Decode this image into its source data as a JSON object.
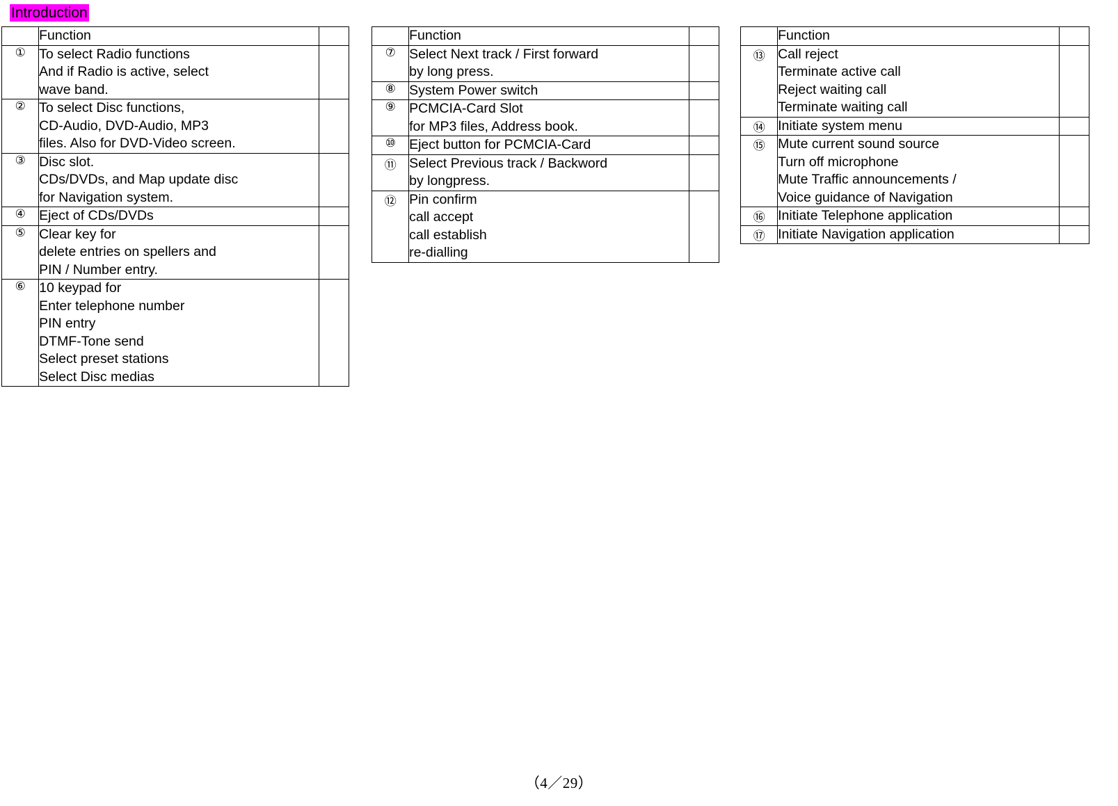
{
  "heading": "Introduction",
  "footer": "（4／29）",
  "tables": [
    {
      "id": "table-1",
      "header": "Function",
      "rows": [
        {
          "num": "①",
          "lines": [
            "To select Radio functions",
            "And if Radio is active, select",
            "wave band."
          ]
        },
        {
          "num": "②",
          "lines": [
            "To select Disc functions,",
            "CD-Audio, DVD-Audio, MP3",
            "files. Also for DVD-Video screen."
          ]
        },
        {
          "num": "③",
          "lines": [
            "Disc slot.",
            "CDs/DVDs, and Map update disc",
            "for Navigation system."
          ]
        },
        {
          "num": "④",
          "lines": [
            "Eject of CDs/DVDs"
          ]
        },
        {
          "num": "⑤",
          "lines": [
            "Clear key for",
            "delete entries on spellers and",
            "PIN / Number entry."
          ]
        },
        {
          "num": "⑥",
          "lines": [
            "10 keypad for",
            "Enter telephone number",
            "PIN entry",
            "DTMF-Tone send",
            "Select preset stations",
            "Select Disc medias"
          ]
        }
      ]
    },
    {
      "id": "table-2",
      "header": "Function",
      "rows": [
        {
          "num": "⑦",
          "lines": [
            "Select Next track / First forward",
            "by long press."
          ]
        },
        {
          "num": "⑧",
          "lines": [
            "System Power switch"
          ]
        },
        {
          "num": "⑨",
          "lines": [
            "PCMCIA-Card Slot",
            "for MP3 files, Address book."
          ]
        },
        {
          "num": "⑩",
          "lines": [
            "Eject button for PCMCIA-Card"
          ]
        },
        {
          "num": "⑪",
          "lines": [
            "Select Previous track / Backword",
            "by longpress."
          ]
        },
        {
          "num": "⑫",
          "lines": [
            "Pin confirm",
            "call accept",
            "call establish",
            "re-dialling"
          ]
        }
      ]
    },
    {
      "id": "table-3",
      "header": "Function",
      "rows": [
        {
          "num": "⑬",
          "lines": [
            "Call reject",
            "Terminate active call",
            "Reject waiting call",
            "Terminate waiting call"
          ]
        },
        {
          "num": "⑭",
          "lines": [
            "Initiate system menu"
          ]
        },
        {
          "num": "⑮",
          "lines": [
            "Mute current sound source",
            "Turn off microphone",
            "Mute Traffic announcements /",
            "Voice guidance of Navigation"
          ]
        },
        {
          "num": "⑯",
          "lines": [
            "Initiate Telephone application"
          ]
        },
        {
          "num": "⑰",
          "lines": [
            "Initiate Navigation application"
          ]
        }
      ]
    }
  ]
}
